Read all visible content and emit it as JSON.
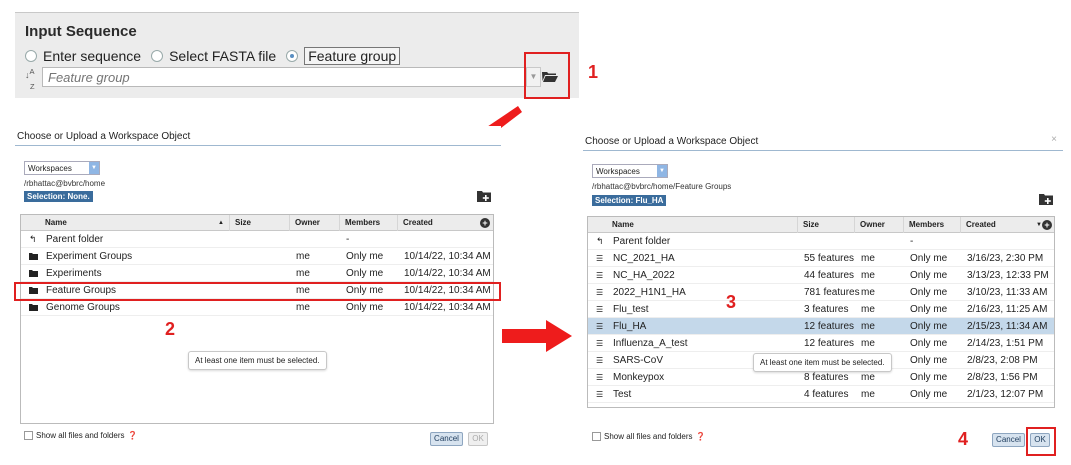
{
  "input_panel": {
    "title": "Input Sequence",
    "radio_enter": "Enter sequence",
    "radio_fasta": "Select FASTA file",
    "radio_feature": "Feature group",
    "placeholder": "Feature group",
    "callout": "1"
  },
  "dialog_left": {
    "title": "Choose or Upload a Workspace Object",
    "workspace": "Workspaces",
    "path": "/rbhattac@bvbrc/home",
    "selection": "Selection: None.",
    "headers": {
      "name": "Name",
      "size": "Size",
      "owner": "Owner",
      "members": "Members",
      "created": "Created"
    },
    "rows": [
      {
        "name": "Parent folder",
        "size": "",
        "owner": "",
        "members": "-",
        "created": ""
      },
      {
        "name": "Experiment Groups",
        "size": "",
        "owner": "me",
        "members": "Only me",
        "created": "10/14/22, 10:34 AM"
      },
      {
        "name": "Experiments",
        "size": "",
        "owner": "me",
        "members": "Only me",
        "created": "10/14/22, 10:34 AM"
      },
      {
        "name": "Feature Groups",
        "size": "",
        "owner": "me",
        "members": "Only me",
        "created": "10/14/22, 10:34 AM"
      },
      {
        "name": "Genome Groups",
        "size": "",
        "owner": "me",
        "members": "Only me",
        "created": "10/14/22, 10:34 AM"
      }
    ],
    "tooltip": "At least one item must be selected.",
    "callout": "2",
    "show_all": "Show all files and folders",
    "cancel": "Cancel",
    "ok": "OK"
  },
  "dialog_right": {
    "title": "Choose or Upload a Workspace Object",
    "close": "×",
    "workspace": "Workspaces",
    "path": "/rbhattac@bvbrc/home/Feature Groups",
    "selection": "Selection: Flu_HA",
    "headers": {
      "name": "Name",
      "size": "Size",
      "owner": "Owner",
      "members": "Members",
      "created": "Created"
    },
    "rows": [
      {
        "name": "Parent folder",
        "size": "",
        "owner": "",
        "members": "-",
        "created": ""
      },
      {
        "name": "NC_2021_HA",
        "size": "55 features",
        "owner": "me",
        "members": "Only me",
        "created": "3/16/23, 2:30 PM"
      },
      {
        "name": "NC_HA_2022",
        "size": "44 features",
        "owner": "me",
        "members": "Only me",
        "created": "3/13/23, 12:33 PM"
      },
      {
        "name": "2022_H1N1_HA",
        "size": "781 features",
        "owner": "me",
        "members": "Only me",
        "created": "3/10/23, 11:33 AM"
      },
      {
        "name": "Flu_test",
        "size": "3 features",
        "owner": "me",
        "members": "Only me",
        "created": "2/16/23, 11:25 AM"
      },
      {
        "name": "Flu_HA",
        "size": "12 features",
        "owner": "me",
        "members": "Only me",
        "created": "2/15/23, 11:34 AM"
      },
      {
        "name": "Influenza_A_test",
        "size": "12 features",
        "owner": "me",
        "members": "Only me",
        "created": "2/14/23, 1:51 PM"
      },
      {
        "name": "SARS-CoV",
        "size": "",
        "owner": "",
        "members": "Only me",
        "created": "2/8/23, 2:08 PM"
      },
      {
        "name": "Monkeypox",
        "size": "8 features",
        "owner": "me",
        "members": "Only me",
        "created": "2/8/23, 1:56 PM"
      },
      {
        "name": "Test",
        "size": "4 features",
        "owner": "me",
        "members": "Only me",
        "created": "2/1/23, 12:07 PM"
      }
    ],
    "tooltip": "At least one item must be selected.",
    "callout_3": "3",
    "callout_4": "4",
    "show_all": "Show all files and folders",
    "cancel": "Cancel",
    "ok": "OK"
  }
}
